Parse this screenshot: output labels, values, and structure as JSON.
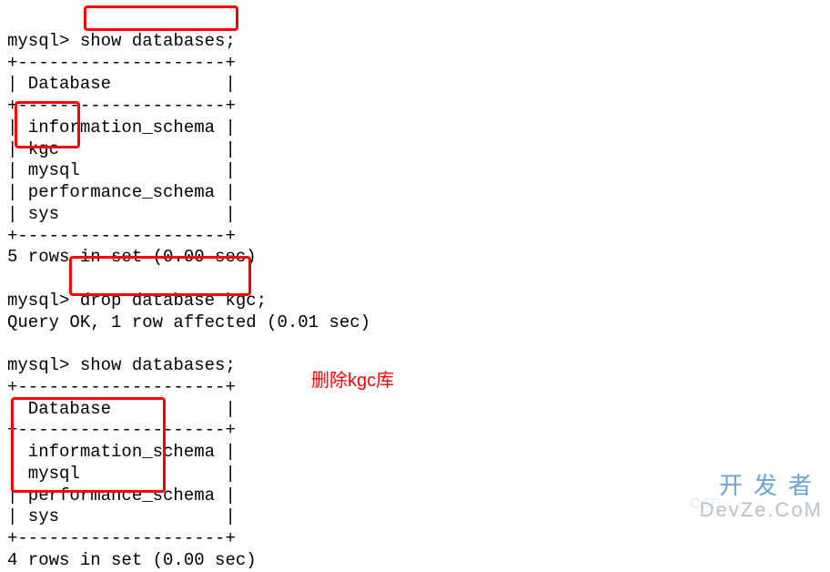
{
  "session1": {
    "prompt": "mysql> ",
    "cmd_show": "show databases;",
    "sep_top": "+--------------------+",
    "header": "| Database           |",
    "sep_mid": "+--------------------+",
    "rows": [
      "| information_schema |",
      "| kgc                |",
      "| mysql              |",
      "| performance_schema |",
      "| sys                |"
    ],
    "sep_bot": "+--------------------+",
    "footer": "5 rows in set (0.00 sec)"
  },
  "drop_cmd": {
    "prompt": "mysql> ",
    "cmd": "drop database kgc;",
    "result": "Query OK, 1 row affected (0.01 sec)"
  },
  "session2": {
    "prompt": "mysql> ",
    "cmd_show": "show databases;",
    "sep_top": "+--------------------+",
    "header": "| Database           |",
    "sep_mid": "+--------------------+",
    "rows": [
      "| information_schema |",
      "| mysql              |",
      "| performance_schema |",
      "| sys                |"
    ],
    "sep_bot": "+--------------------+",
    "footer": "4 rows in set (0.00 sec)"
  },
  "annotation": "删除kgc库",
  "watermark": {
    "line1": "开发者",
    "line2": "DevZe.CoM",
    "ghost": "CSD"
  }
}
